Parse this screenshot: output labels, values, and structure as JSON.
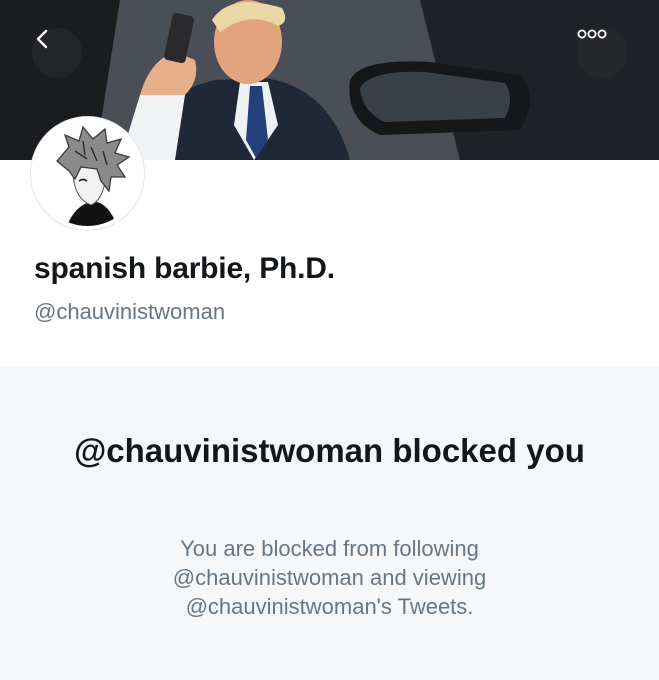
{
  "header": {
    "back_icon": "chevron-left-icon",
    "more_icon": "more-options-icon"
  },
  "profile": {
    "display_name": "spanish barbie, Ph.D.",
    "handle": "@chauvinistwoman",
    "avatar_icon": "anime-character-avatar"
  },
  "blocked": {
    "title": "@chauvinistwoman blocked you",
    "message": "You are blocked from following @chauvinistwoman and viewing @chauvinistwoman's Tweets."
  },
  "colors": {
    "name_text": "#14171a",
    "secondary_text": "#657786",
    "panel_background": "#f5f8fa"
  }
}
